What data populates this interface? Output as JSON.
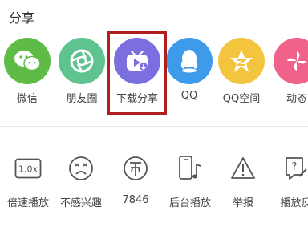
{
  "title": "分享",
  "share_items": [
    {
      "label": "微信",
      "color": "#5dbb46",
      "icon": "wechat-icon"
    },
    {
      "label": "朋友圈",
      "color": "#5ec38e",
      "icon": "moments-icon"
    },
    {
      "label": "下载分享",
      "color": "#7b6fe0",
      "icon": "download-share-icon"
    },
    {
      "label": "QQ",
      "color": "#3d9be9",
      "icon": "qq-icon"
    },
    {
      "label": "QQ空间",
      "color": "#f3c53f",
      "icon": "qzone-icon"
    },
    {
      "label": "动态",
      "color": "#f0628a",
      "icon": "moments-pinwheel-icon"
    }
  ],
  "actions": [
    {
      "label": "倍速播放",
      "icon": "speed-icon",
      "speed_text": "1.0x"
    },
    {
      "label": "不感兴趣",
      "icon": "not-interested-icon"
    },
    {
      "label": "7846",
      "icon": "coin-icon"
    },
    {
      "label": "后台播放",
      "icon": "background-play-icon"
    },
    {
      "label": "举报",
      "icon": "report-icon"
    },
    {
      "label": "播放反",
      "icon": "playback-feedback-icon"
    }
  ]
}
